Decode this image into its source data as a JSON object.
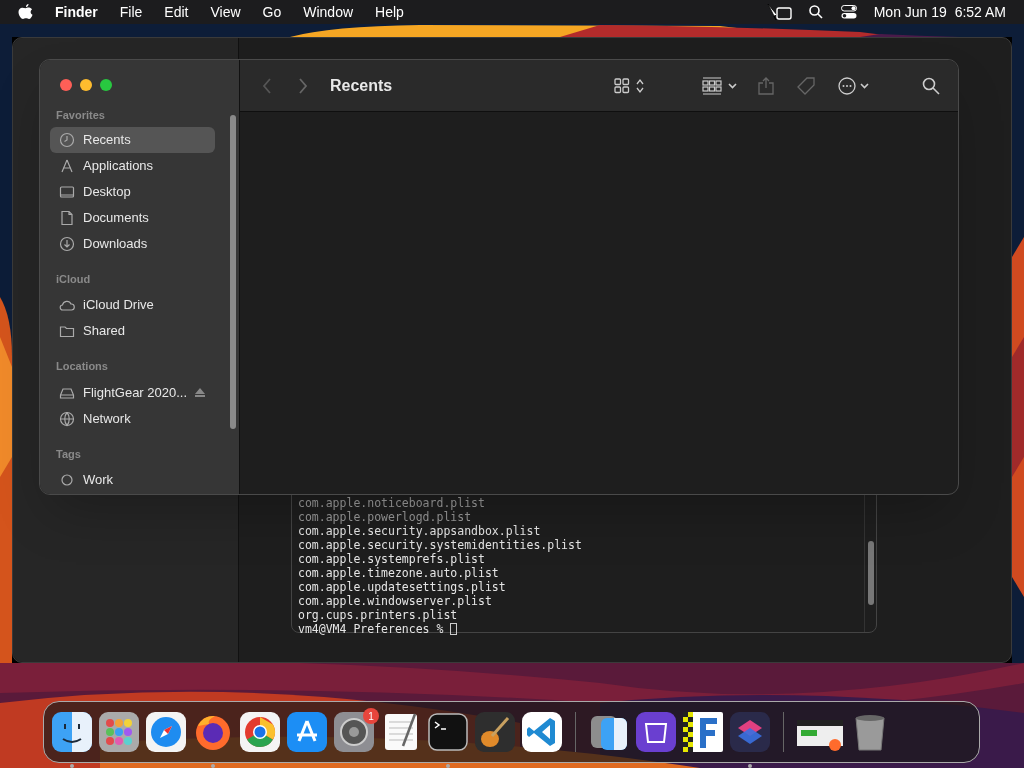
{
  "menu_bar": {
    "app": "Finder",
    "menus": [
      "File",
      "Edit",
      "View",
      "Go",
      "Window",
      "Help"
    ],
    "clock": "Mon Jun 19  6:52 AM"
  },
  "finder": {
    "title": "Recents",
    "sidebar": [
      {
        "header": "Favorites",
        "items": [
          {
            "label": "Recents",
            "kind": "clock",
            "selected": true
          },
          {
            "label": "Applications",
            "kind": "apps",
            "selected": false
          },
          {
            "label": "Desktop",
            "kind": "desktop",
            "selected": false
          },
          {
            "label": "Documents",
            "kind": "doc",
            "selected": false
          },
          {
            "label": "Downloads",
            "kind": "download",
            "selected": false
          }
        ]
      },
      {
        "header": "iCloud",
        "items": [
          {
            "label": "iCloud Drive",
            "kind": "cloud",
            "selected": false
          },
          {
            "label": "Shared",
            "kind": "shared",
            "selected": false
          }
        ]
      },
      {
        "header": "Locations",
        "items": [
          {
            "label": "FlightGear 2020...",
            "kind": "disk",
            "selected": false,
            "ejectable": true
          },
          {
            "label": "Network",
            "kind": "globe",
            "selected": false
          }
        ]
      },
      {
        "header": "Tags",
        "items": [
          {
            "label": "Work",
            "kind": "tag",
            "selected": false
          }
        ]
      }
    ]
  },
  "terminal": {
    "lines": [
      "com.apple.noticeboard.plist",
      "com.apple.powerlogd.plist",
      "com.apple.security.appsandbox.plist",
      "com.apple.security.systemidentities.plist",
      "com.apple.systemprefs.plist",
      "com.apple.timezone.auto.plist",
      "com.apple.updatesettings.plist",
      "com.apple.windowserver.plist",
      "org.cups.printers.plist"
    ],
    "prompt": "vm4@VM4 Preferences %"
  },
  "dock": {
    "apps": [
      {
        "kind": "finder",
        "running": true
      },
      {
        "kind": "launchpad",
        "running": false
      },
      {
        "kind": "safari",
        "running": false
      },
      {
        "kind": "firefox",
        "running": true
      },
      {
        "kind": "chrome",
        "running": false
      },
      {
        "kind": "appstore",
        "running": false
      },
      {
        "kind": "settings",
        "running": false,
        "badge": "1"
      },
      {
        "kind": "textedit",
        "running": false
      },
      {
        "kind": "terminal",
        "running": true
      },
      {
        "kind": "guitar",
        "running": false
      },
      {
        "kind": "vscode",
        "running": false
      },
      {
        "kind": "separator"
      },
      {
        "kind": "migration",
        "running": false
      },
      {
        "kind": "configurator",
        "running": false
      },
      {
        "kind": "fapp",
        "running": false
      },
      {
        "kind": "shortcuts",
        "running": true
      },
      {
        "kind": "separator"
      },
      {
        "kind": "window",
        "running": false
      },
      {
        "kind": "trash",
        "running": false
      }
    ]
  }
}
